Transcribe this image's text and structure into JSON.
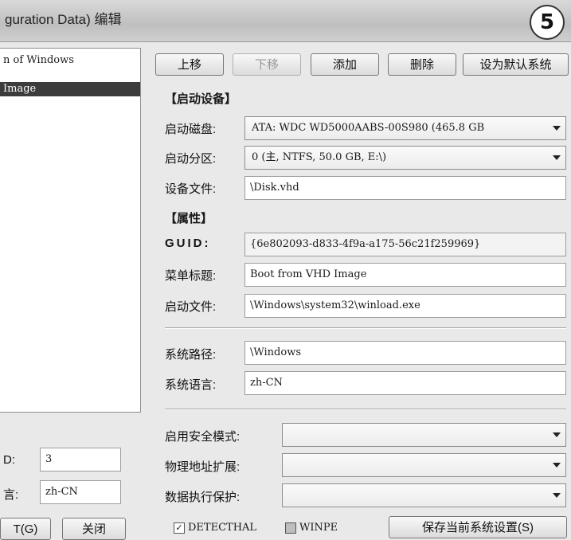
{
  "window": {
    "title": "guration Data) 编辑",
    "step_badge": "5"
  },
  "os_list": {
    "items": [
      {
        "label": "n of Windows",
        "selected": false
      },
      {
        "label": "Image",
        "selected": true
      }
    ]
  },
  "toolbar": {
    "up": "上移",
    "down": "下移",
    "add": "添加",
    "delete": "删除",
    "set_default": "设为默认系统"
  },
  "boot_device": {
    "section": "【启动设备】",
    "disk_label": "启动磁盘:",
    "disk_value": "ATA: WDC WD5000AABS-00S980 (465.8 GB",
    "partition_label": "启动分区:",
    "partition_value": "0 (主, NTFS, 50.0 GB, E:\\)",
    "device_file_label": "设备文件:",
    "device_file_value": "\\Disk.vhd"
  },
  "attributes": {
    "section": "【属性】",
    "guid_label": "GUID:",
    "guid_value": "{6e802093-d833-4f9a-a175-56c21f259969}",
    "menu_title_label": "菜单标题:",
    "menu_title_value": "Boot from VHD Image",
    "boot_file_label": "启动文件:",
    "boot_file_value": "\\Windows\\system32\\winload.exe",
    "system_path_label": "系统路径:",
    "system_path_value": "\\Windows",
    "system_lang_label": "系统语言:",
    "system_lang_value": "zh-CN"
  },
  "options": {
    "safe_mode_label": "启用安全模式:",
    "safe_mode_value": "",
    "pae_label": "物理地址扩展:",
    "pae_value": "",
    "dep_label": "数据执行保护:",
    "dep_value": ""
  },
  "left_bottom": {
    "timeout_label": "D:",
    "timeout_value": "3",
    "lang_label": "言:",
    "lang_value": "zh-CN",
    "apply_button": "T(G)",
    "close_button": "关闭"
  },
  "bottom": {
    "detecthal_label": "DETECTHAL",
    "detecthal_checked": true,
    "winpe_label": "WINPE",
    "winpe_checked": false,
    "save_button": "保存当前系统设置(S)"
  }
}
